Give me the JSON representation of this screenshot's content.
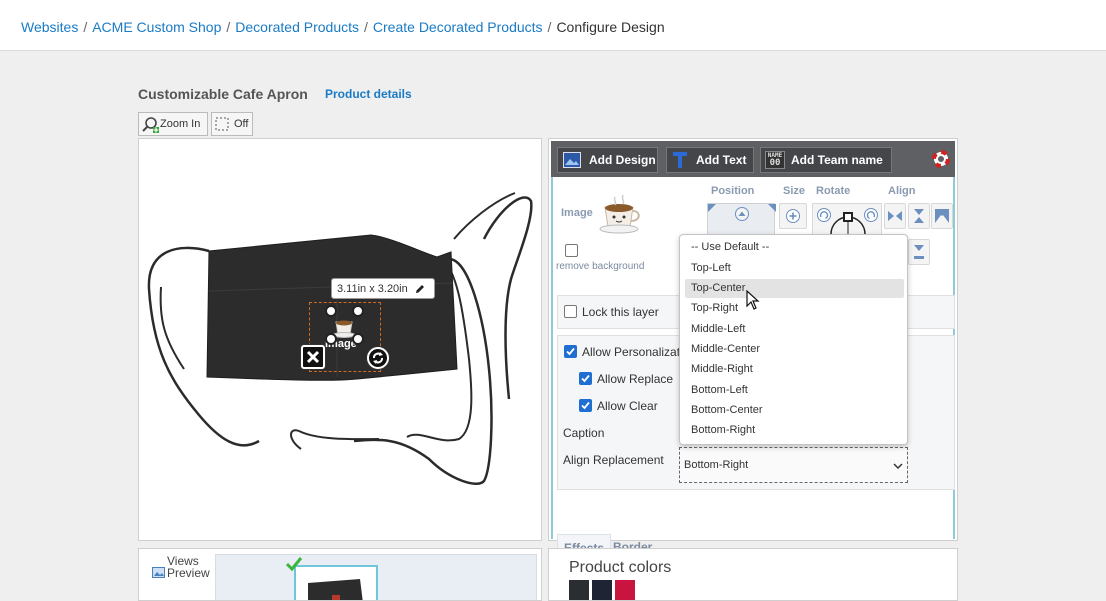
{
  "breadcrumb": {
    "items": [
      "Websites",
      "ACME Custom Shop",
      "Decorated Products",
      "Create Decorated Products"
    ],
    "current": "Configure Design"
  },
  "product": {
    "title": "Customizable Cafe Apron",
    "details_link": "Product details"
  },
  "toolbar": {
    "zoom_label": "Zoom In",
    "off_label": "Off"
  },
  "canvas": {
    "dimension_label": "3.11in x 3.20in",
    "design_text": "Image"
  },
  "views": {
    "title": "Views",
    "subtitle": "Preview"
  },
  "panel": {
    "add_design": "Add Design",
    "add_text": "Add Text",
    "add_team_name": "Add Team name",
    "team_icon_text_top": "NAME",
    "team_icon_text_bottom": "00",
    "headers": {
      "position": "Position",
      "size": "Size",
      "rotate": "Rotate",
      "align": "Align"
    },
    "image_label": "Image",
    "remove_background": "remove background",
    "lock_layer": "Lock this layer",
    "allow_personalization": "Allow Personalization",
    "allow_replace": "Allow Replace",
    "allow_clear": "Allow Clear",
    "caption": "Caption",
    "align_replacement": "Align Replacement",
    "align_replacement_value": "Bottom-Right",
    "tabs": [
      "Effects",
      "Border"
    ]
  },
  "dropdown": {
    "options": [
      "-- Use Default --",
      "Top-Left",
      "Top-Center",
      "Top-Right",
      "Middle-Left",
      "Middle-Center",
      "Middle-Right",
      "Bottom-Left",
      "Bottom-Center",
      "Bottom-Right"
    ],
    "highlighted": "Top-Center"
  },
  "product_colors": {
    "title": "Product colors",
    "swatches": [
      "#2a2d31",
      "#1e2433",
      "#c8143f"
    ]
  },
  "colors": {
    "link": "#1a7bc4",
    "checkbox": "#1f6fd2",
    "toolbar": "#5f6064"
  }
}
